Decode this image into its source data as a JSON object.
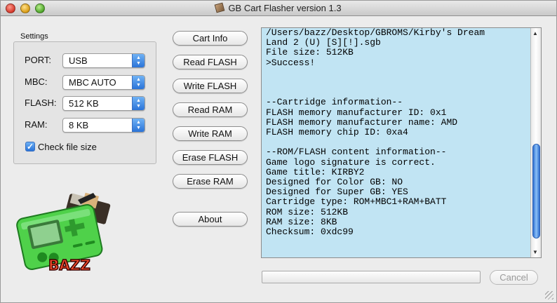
{
  "window": {
    "title": "GB Cart Flasher version 1.3"
  },
  "settings": {
    "group_label": "Settings",
    "port": {
      "label": "PORT:",
      "value": "USB"
    },
    "mbc": {
      "label": "MBC:",
      "value": "MBC AUTO"
    },
    "flash": {
      "label": "FLASH:",
      "value": "512 KB"
    },
    "ram": {
      "label": "RAM:",
      "value": "8 KB"
    },
    "check_file_size": {
      "label": "Check file size",
      "checked": true
    }
  },
  "buttons": {
    "cart_info": "Cart Info",
    "read_flash": "Read FLASH",
    "write_flash": "Write FLASH",
    "read_ram": "Read RAM",
    "write_ram": "Write RAM",
    "erase_flash": "Erase FLASH",
    "erase_ram": "Erase RAM",
    "about": "About"
  },
  "logo_text": "BAZZ",
  "console": {
    "lines": [
      "/Users/bazz/Desktop/GBROMS/Kirby's Dream",
      "Land 2 (U) [S][!].sgb",
      "File size: 512KB",
      ">Success!",
      "",
      "",
      "",
      "--Cartridge information--",
      "FLASH memory manufacturer ID: 0x1",
      "FLASH memory manufacturer name: AMD",
      "FLASH memory chip ID: 0xa4",
      "",
      "--ROM/FLASH content information--",
      "Game logo signature is correct.",
      "Game title: KIRBY2",
      "Designed for Color GB: NO",
      "Designed for Super GB: YES",
      "Cartridge type: ROM+MBC1+RAM+BATT",
      "ROM size: 512KB",
      "RAM size: 8KB",
      "Checksum: 0xdc99"
    ]
  },
  "progress": {
    "value": 0
  },
  "cancel_label": "Cancel",
  "colors": {
    "console_bg": "#c1e4f3",
    "accent": "#2a73d8"
  }
}
